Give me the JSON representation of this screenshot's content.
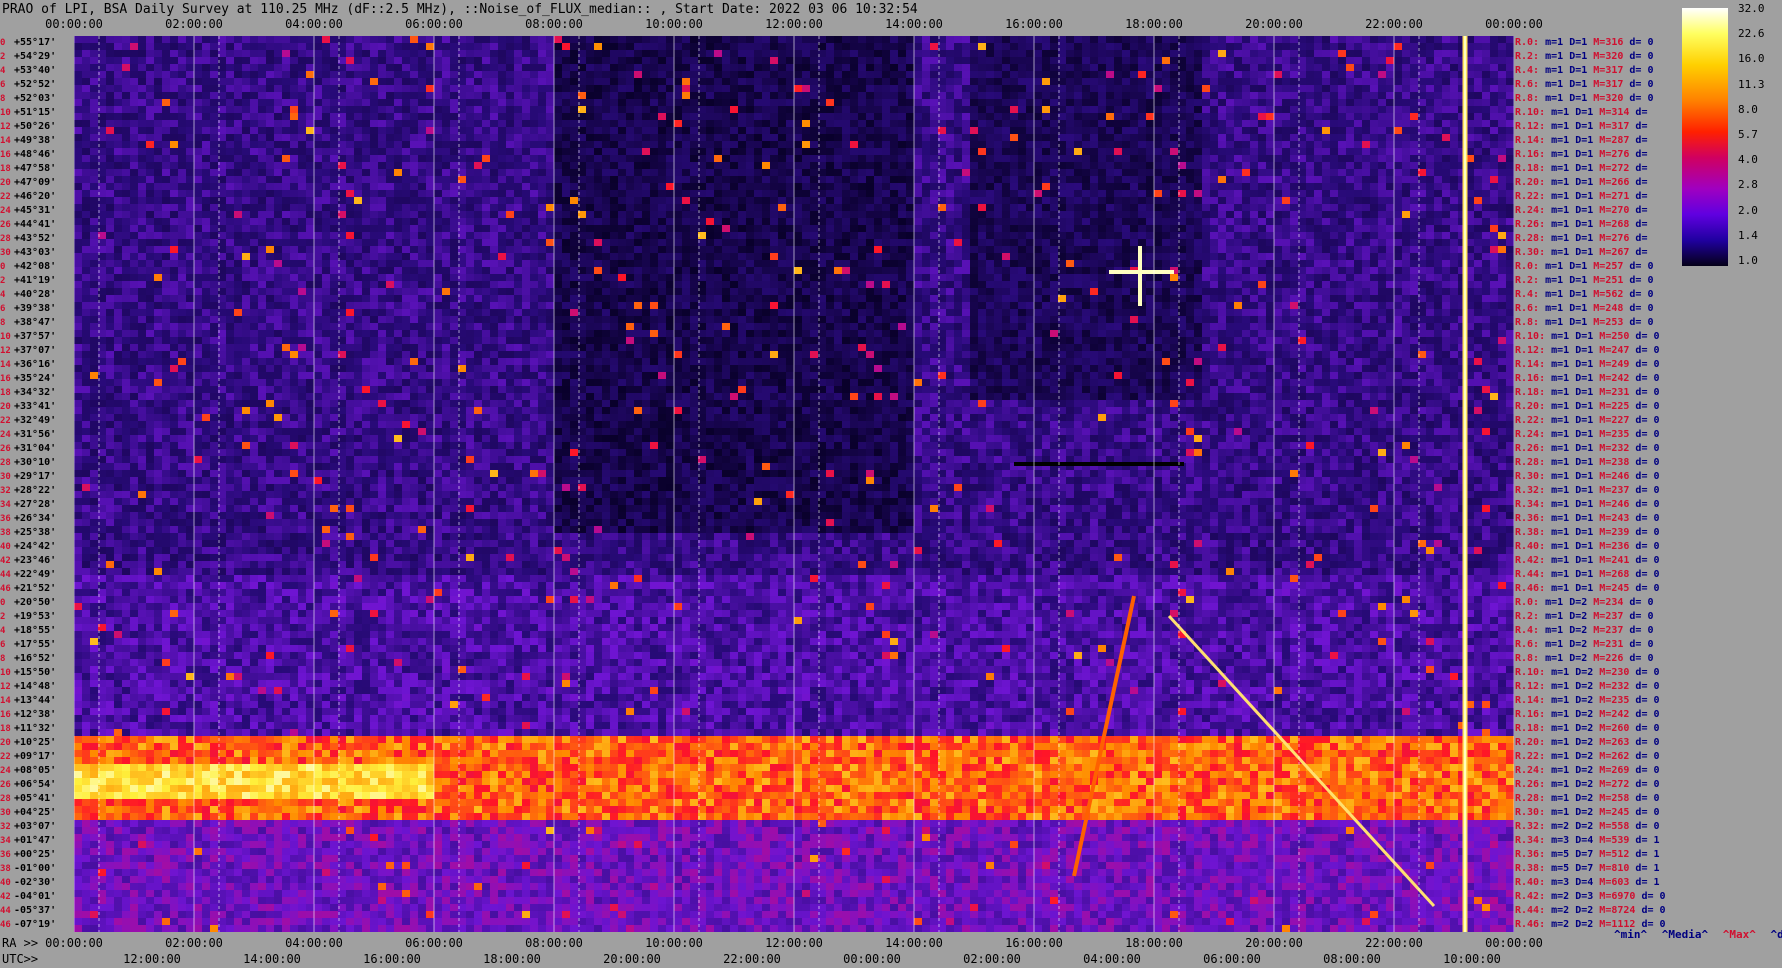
{
  "title": "PRAO of LPI, BSA Daily Survey at 110.25 MHz (dF::2.5 MHz), ::Noise_of_FLUX_median:: , Start Date: 2022 03 06 10:32:54",
  "top_axis": [
    "00:00:00",
    "02:00:00",
    "04:00:00",
    "06:00:00",
    "08:00:00",
    "10:00:00",
    "12:00:00",
    "14:00:00",
    "16:00:00",
    "18:00:00",
    "20:00:00",
    "22:00:00",
    "00:00:00"
  ],
  "ra_prefix": "RA >>",
  "ra_axis": [
    "00:00:00",
    "02:00:00",
    "04:00:00",
    "06:00:00",
    "08:00:00",
    "10:00:00",
    "12:00:00",
    "14:00:00",
    "16:00:00",
    "18:00:00",
    "20:00:00",
    "22:00:00",
    "00:00:00"
  ],
  "utc_prefix": "UTC>>",
  "utc_axis": [
    "12:00:00",
    "14:00:00",
    "16:00:00",
    "18:00:00",
    "20:00:00",
    "22:00:00",
    "00:00:00",
    "02:00:00",
    "04:00:00",
    "06:00:00",
    "08:00:00",
    "10:00:00"
  ],
  "declinations": [
    "+55°17'",
    "+54°29'",
    "+53°40'",
    "+52°52'",
    "+52°03'",
    "+51°15'",
    "+50°26'",
    "+49°38'",
    "+48°46'",
    "+47°58'",
    "+47°09'",
    "+46°20'",
    "+45°31'",
    "+44°41'",
    "+43°52'",
    "+43°03'",
    "+42°08'",
    "+41°19'",
    "+40°28'",
    "+39°38'",
    "+38°47'",
    "+37°57'",
    "+37°07'",
    "+36°16'",
    "+35°24'",
    "+34°32'",
    "+33°41'",
    "+32°49'",
    "+31°56'",
    "+31°04'",
    "+30°10'",
    "+29°17'",
    "+28°22'",
    "+27°28'",
    "+26°34'",
    "+25°38'",
    "+24°42'",
    "+23°46'",
    "+22°49'",
    "+21°52'",
    "+20°50'",
    "+19°53'",
    "+18°55'",
    "+17°55'",
    "+16°52'",
    "+15°50'",
    "+14°48'",
    "+13°44'",
    "+12°38'",
    "+11°32'",
    "+10°25'",
    "+09°17'",
    "+08°05'",
    "+06°54'",
    "+05°41'",
    "+04°25'",
    "+03°07'",
    "+01°47'",
    "+00°25'",
    "-01°00'",
    "-02°30'",
    "-04°01'",
    "-05°37'",
    "-07°19'"
  ],
  "row_indices": [
    "0",
    "2",
    "4",
    "6",
    "8",
    "10",
    "12",
    "14",
    "16",
    "18",
    "20",
    "22",
    "24",
    "26",
    "28",
    "30",
    "0",
    "2",
    "4",
    "6",
    "8",
    "10",
    "12",
    "14",
    "16",
    "18",
    "20",
    "22",
    "24",
    "26",
    "28",
    "30",
    "32",
    "34",
    "36",
    "38",
    "40",
    "42",
    "44",
    "46",
    "0",
    "2",
    "4",
    "6",
    "8",
    "10",
    "12",
    "14",
    "16",
    "18",
    "20",
    "22",
    "24",
    "26",
    "28",
    "30",
    "32",
    "34",
    "36",
    "38",
    "40",
    "42",
    "44",
    "46"
  ],
  "right_rows": [
    {
      "r": "R.0:",
      "m": "m=1 D=1",
      "M": "M=316",
      "d": "d= 0"
    },
    {
      "r": "R.2:",
      "m": "m=1 D=1",
      "M": "M=320",
      "d": "d= 0"
    },
    {
      "r": "R.4:",
      "m": "m=1 D=1",
      "M": "M=317",
      "d": "d= 0"
    },
    {
      "r": "R.6:",
      "m": "m=1 D=1",
      "M": "M=317",
      "d": "d= 0"
    },
    {
      "r": "R.8:",
      "m": "m=1 D=1",
      "M": "M=320",
      "d": "d= 0"
    },
    {
      "r": "R.10:",
      "m": "m=1 D=1",
      "M": "M=314",
      "d": "d="
    },
    {
      "r": "R.12:",
      "m": "m=1 D=1",
      "M": "M=317",
      "d": "d="
    },
    {
      "r": "R.14:",
      "m": "m=1 D=1",
      "M": "M=287",
      "d": "d="
    },
    {
      "r": "R.16:",
      "m": "m=1 D=1",
      "M": "M=276",
      "d": "d="
    },
    {
      "r": "R.18:",
      "m": "m=1 D=1",
      "M": "M=272",
      "d": "d="
    },
    {
      "r": "R.20:",
      "m": "m=1 D=1",
      "M": "M=266",
      "d": "d="
    },
    {
      "r": "R.22:",
      "m": "m=1 D=1",
      "M": "M=271",
      "d": "d="
    },
    {
      "r": "R.24:",
      "m": "m=1 D=1",
      "M": "M=270",
      "d": "d="
    },
    {
      "r": "R.26:",
      "m": "m=1 D=1",
      "M": "M=268",
      "d": "d="
    },
    {
      "r": "R.28:",
      "m": "m=1 D=1",
      "M": "M=276",
      "d": "d="
    },
    {
      "r": "R.30:",
      "m": "m=1 D=1",
      "M": "M=267",
      "d": "d="
    },
    {
      "r": "R.0:",
      "m": "m=1 D=1",
      "M": "M=257",
      "d": "d= 0"
    },
    {
      "r": "R.2:",
      "m": "m=1 D=1",
      "M": "M=251",
      "d": "d= 0"
    },
    {
      "r": "R.4:",
      "m": "m=1 D=1",
      "M": "M=562",
      "d": "d= 0"
    },
    {
      "r": "R.6:",
      "m": "m=1 D=1",
      "M": "M=248",
      "d": "d= 0"
    },
    {
      "r": "R.8:",
      "m": "m=1 D=1",
      "M": "M=253",
      "d": "d= 0"
    },
    {
      "r": "R.10:",
      "m": "m=1 D=1",
      "M": "M=250",
      "d": "d= 0"
    },
    {
      "r": "R.12:",
      "m": "m=1 D=1",
      "M": "M=247",
      "d": "d= 0"
    },
    {
      "r": "R.14:",
      "m": "m=1 D=1",
      "M": "M=249",
      "d": "d= 0"
    },
    {
      "r": "R.16:",
      "m": "m=1 D=1",
      "M": "M=242",
      "d": "d= 0"
    },
    {
      "r": "R.18:",
      "m": "m=1 D=1",
      "M": "M=231",
      "d": "d= 0"
    },
    {
      "r": "R.20:",
      "m": "m=1 D=1",
      "M": "M=225",
      "d": "d= 0"
    },
    {
      "r": "R.22:",
      "m": "m=1 D=1",
      "M": "M=227",
      "d": "d= 0"
    },
    {
      "r": "R.24:",
      "m": "m=1 D=1",
      "M": "M=235",
      "d": "d= 0"
    },
    {
      "r": "R.26:",
      "m": "m=1 D=1",
      "M": "M=232",
      "d": "d= 0"
    },
    {
      "r": "R.28:",
      "m": "m=1 D=1",
      "M": "M=238",
      "d": "d= 0"
    },
    {
      "r": "R.30:",
      "m": "m=1 D=1",
      "M": "M=246",
      "d": "d= 0"
    },
    {
      "r": "R.32:",
      "m": "m=1 D=1",
      "M": "M=237",
      "d": "d= 0"
    },
    {
      "r": "R.34:",
      "m": "m=1 D=1",
      "M": "M=246",
      "d": "d= 0"
    },
    {
      "r": "R.36:",
      "m": "m=1 D=1",
      "M": "M=243",
      "d": "d= 0"
    },
    {
      "r": "R.38:",
      "m": "m=1 D=1",
      "M": "M=239",
      "d": "d= 0"
    },
    {
      "r": "R.40:",
      "m": "m=1 D=1",
      "M": "M=236",
      "d": "d= 0"
    },
    {
      "r": "R.42:",
      "m": "m=1 D=1",
      "M": "M=241",
      "d": "d= 0"
    },
    {
      "r": "R.44:",
      "m": "m=1 D=1",
      "M": "M=268",
      "d": "d= 0"
    },
    {
      "r": "R.46:",
      "m": "m=1 D=1",
      "M": "M=245",
      "d": "d= 0"
    },
    {
      "r": "R.0:",
      "m": "m=1 D=2",
      "M": "M=234",
      "d": "d= 0"
    },
    {
      "r": "R.2:",
      "m": "m=1 D=2",
      "M": "M=237",
      "d": "d= 0"
    },
    {
      "r": "R.4:",
      "m": "m=1 D=2",
      "M": "M=237",
      "d": "d= 0"
    },
    {
      "r": "R.6:",
      "m": "m=1 D=2",
      "M": "M=231",
      "d": "d= 0"
    },
    {
      "r": "R.8:",
      "m": "m=1 D=2",
      "M": "M=226",
      "d": "d= 0"
    },
    {
      "r": "R.10:",
      "m": "m=1 D=2",
      "M": "M=230",
      "d": "d= 0"
    },
    {
      "r": "R.12:",
      "m": "m=1 D=2",
      "M": "M=232",
      "d": "d= 0"
    },
    {
      "r": "R.14:",
      "m": "m=1 D=2",
      "M": "M=235",
      "d": "d= 0"
    },
    {
      "r": "R.16:",
      "m": "m=1 D=2",
      "M": "M=242",
      "d": "d= 0"
    },
    {
      "r": "R.18:",
      "m": "m=1 D=2",
      "M": "M=260",
      "d": "d= 0"
    },
    {
      "r": "R.20:",
      "m": "m=1 D=2",
      "M": "M=263",
      "d": "d= 0"
    },
    {
      "r": "R.22:",
      "m": "m=1 D=2",
      "M": "M=262",
      "d": "d= 0"
    },
    {
      "r": "R.24:",
      "m": "m=1 D=2",
      "M": "M=269",
      "d": "d= 0"
    },
    {
      "r": "R.26:",
      "m": "m=1 D=2",
      "M": "M=272",
      "d": "d= 0"
    },
    {
      "r": "R.28:",
      "m": "m=1 D=2",
      "M": "M=258",
      "d": "d= 0"
    },
    {
      "r": "R.30:",
      "m": "m=1 D=2",
      "M": "M=245",
      "d": "d= 0"
    },
    {
      "r": "R.32:",
      "m": "m=2 D=2",
      "M": "M=558",
      "d": "d= 0"
    },
    {
      "r": "R.34:",
      "m": "m=3 D=4",
      "M": "M=539",
      "d": "d= 1"
    },
    {
      "r": "R.36:",
      "m": "m=5 D=7",
      "M": "M=512",
      "d": "d= 1"
    },
    {
      "r": "R.38:",
      "m": "m=5 D=7",
      "M": "M=810",
      "d": "d= 1"
    },
    {
      "r": "R.40:",
      "m": "m=3 D=4",
      "M": "M=603",
      "d": "d= 1"
    },
    {
      "r": "R.42:",
      "m": "m=2 D=3",
      "M": "M=6970",
      "d": "d= 0"
    },
    {
      "r": "R.44:",
      "m": "m=2 D=2",
      "M": "M=8724",
      "d": "d= 0"
    },
    {
      "r": "R.46:",
      "m": "m=2 D=2",
      "M": "M=1112",
      "d": "d= 0"
    }
  ],
  "colorbar_ticks": [
    "32.0",
    "22.6",
    "16.0",
    "11.3",
    "8.0",
    "5.7",
    "4.0",
    "2.8",
    "2.0",
    "1.4",
    "1.0"
  ],
  "legend": {
    "min": "^min^",
    "median": "^Media^",
    "max": "^Max^",
    "devia": "^devia^"
  },
  "colors": {
    "background": "#a0a0a0",
    "low": "#0a0033",
    "mid": "#5a10c0",
    "high": "#ff3000",
    "peak": "#ffffa0"
  }
}
